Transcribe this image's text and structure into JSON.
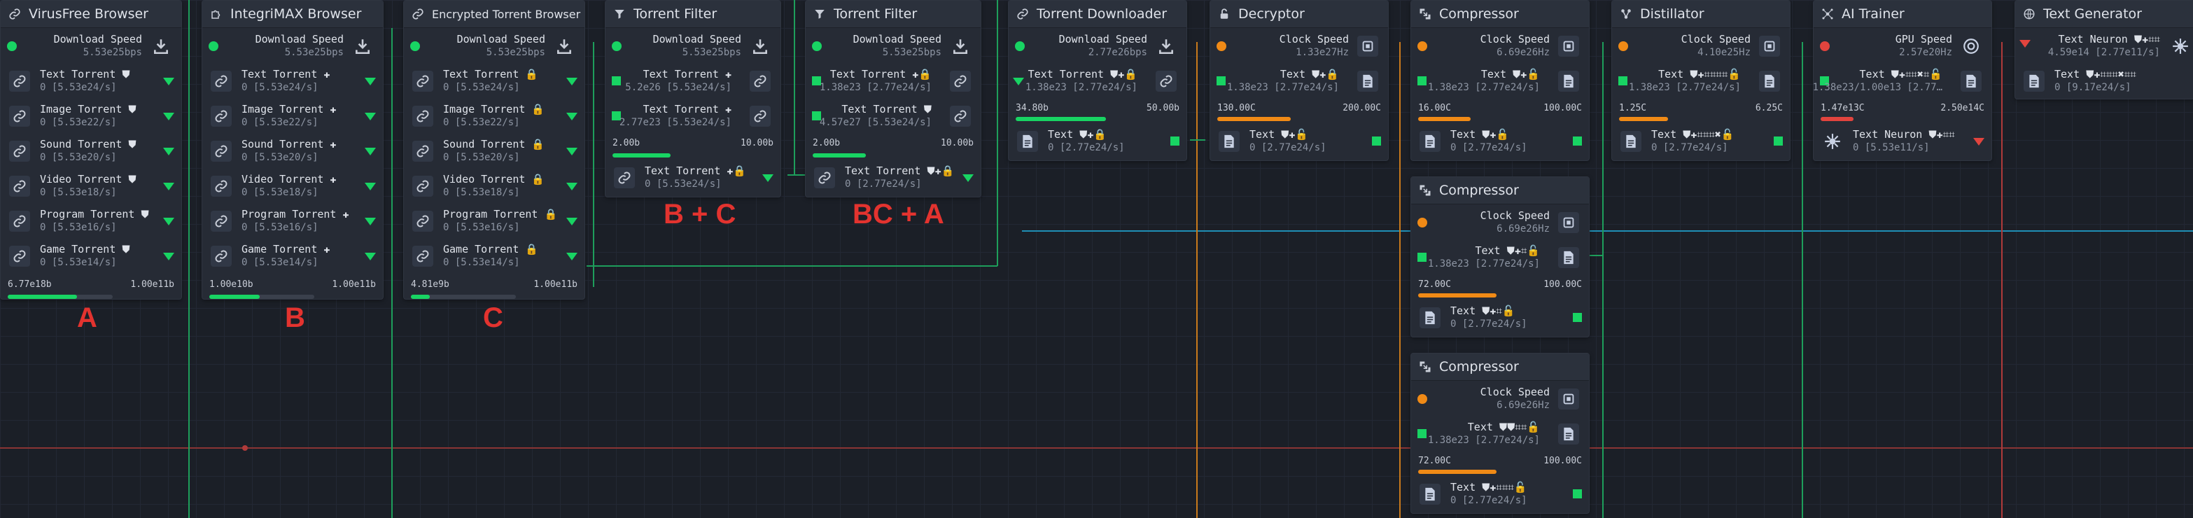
{
  "colors": {
    "green": "#18d463",
    "orange": "#f08a16",
    "red": "#e2443e",
    "bar_green": "#18d463",
    "bar_orange": "#f08a16",
    "bar_red": "#e2443e",
    "wire_green": "#1e9e5b",
    "wire_teal": "#1f8fb5",
    "wire_orange": "#c97a1c",
    "wire_red": "#b03a3a"
  },
  "nodes": {
    "virusfree": {
      "title": "VirusFree Browser",
      "speed_label": "Download Speed",
      "speed_value": "5.53e25bps",
      "items": [
        {
          "label": "Text Torrent ⛊",
          "value": "0 [5.53e24/s]"
        },
        {
          "label": "Image Torrent ⛊",
          "value": "0 [5.53e22/s]"
        },
        {
          "label": "Sound Torrent ⛊",
          "value": "0 [5.53e20/s]"
        },
        {
          "label": "Video Torrent ⛊",
          "value": "0 [5.53e18/s]"
        },
        {
          "label": "Program Torrent ⛊",
          "value": "0 [5.53e16/s]"
        },
        {
          "label": "Game Torrent ⛊",
          "value": "0 [5.53e14/s]"
        }
      ],
      "bar_min": "6.77e18b",
      "bar_max": "1.00e11b",
      "bar_level": 0.66,
      "group": "A"
    },
    "integrimax": {
      "title": "IntegriMAX Browser",
      "speed_label": "Download Speed",
      "speed_value": "5.53e25bps",
      "items": [
        {
          "label": "Text Torrent ✚",
          "value": "0 [5.53e24/s]"
        },
        {
          "label": "Image Torrent ✚",
          "value": "0 [5.53e22/s]"
        },
        {
          "label": "Sound Torrent ✚",
          "value": "0 [5.53e20/s]"
        },
        {
          "label": "Video Torrent ✚",
          "value": "0 [5.53e18/s]"
        },
        {
          "label": "Program Torrent ✚",
          "value": "0 [5.53e16/s]"
        },
        {
          "label": "Game Torrent ✚",
          "value": "0 [5.53e14/s]"
        }
      ],
      "bar_min": "1.00e10b",
      "bar_max": "1.00e11b",
      "bar_level": 0.48,
      "group": "B"
    },
    "encrypted": {
      "title": "Encrypted Torrent Browser",
      "speed_label": "Download Speed",
      "speed_value": "5.53e25bps",
      "items": [
        {
          "label": "Text Torrent 🔒",
          "value": "0 [5.53e24/s]"
        },
        {
          "label": "Image Torrent 🔒",
          "value": "0 [5.53e22/s]"
        },
        {
          "label": "Sound Torrent 🔒",
          "value": "0 [5.53e20/s]"
        },
        {
          "label": "Video Torrent 🔒",
          "value": "0 [5.53e18/s]"
        },
        {
          "label": "Program Torrent 🔒",
          "value": "0 [5.53e16/s]"
        },
        {
          "label": "Game Torrent 🔒",
          "value": "0 [5.53e14/s]"
        }
      ],
      "bar_min": "4.81e9b",
      "bar_max": "1.00e11b",
      "bar_level": 0.18,
      "group": "C"
    },
    "filter1": {
      "title": "Torrent Filter",
      "speed_label": "Download Speed",
      "speed_value": "5.53e25bps",
      "inputs": [
        {
          "label": "Text Torrent ✚",
          "value": "5.2e26 [5.53e24/s]"
        },
        {
          "label": "Text Torrent ✚",
          "value": "2.77e23 [5.53e24/s]"
        }
      ],
      "output": {
        "label": "Text Torrent ✚🔒",
        "value": "0 [5.53e24/s]"
      },
      "bar_min": "2.00b",
      "bar_max": "10.00b",
      "bar_level": 0.36,
      "group": "B + C"
    },
    "filter2": {
      "title": "Torrent Filter",
      "speed_label": "Download Speed",
      "speed_value": "5.53e25bps",
      "inputs": [
        {
          "label": "Text Torrent ✚🔒",
          "value": "1.38e23 [2.77e24/s]"
        },
        {
          "label": "Text Torrent ⛊",
          "value": "4.57e27 [5.53e24/s]"
        }
      ],
      "output": {
        "label": "Text Torrent ⛊✚🔒",
        "value": "0 [2.77e24/s]"
      },
      "bar_min": "2.00b",
      "bar_max": "10.00b",
      "bar_level": 0.33,
      "group": "BC + A"
    },
    "downloader": {
      "title": "Torrent Downloader",
      "speed_label": "Download Speed",
      "speed_value": "2.77e26bps",
      "input": {
        "label": "Text Torrent ⛊✚🔒",
        "value": "1.38e23 [2.77e24/s]"
      },
      "output": {
        "label": "Text ⛊✚🔒",
        "value": "0 [2.77e24/s]"
      },
      "bar_min": "34.80b",
      "bar_max": "50.00b",
      "bar_level": 0.55
    },
    "decryptor": {
      "title": "Decryptor",
      "speed_label": "Clock Speed",
      "speed_value": "1.33e27Hz",
      "input": {
        "label": "Text ⛊✚🔒",
        "value": "1.38e23 [2.77e24/s]"
      },
      "output": {
        "label": "Text ⛊✚🔓",
        "value": "0 [2.77e24/s]"
      },
      "bar_min": "130.00C",
      "bar_max": "200.00C",
      "bar_level": 0.45
    },
    "compressor1": {
      "title": "Compressor",
      "speed_label": "Clock Speed",
      "speed_value": "6.69e26Hz",
      "input": {
        "label": "Text ⛊✚🔓",
        "value": "1.38e23 [2.77e24/s]"
      },
      "output": {
        "label": "Text ⛊✚🔓",
        "value": "0 [2.77e24/s]"
      },
      "bar_min": "16.00C",
      "bar_max": "100.00C",
      "bar_level": 0.32
    },
    "compressor2": {
      "title": "Compressor",
      "speed_label": "Clock Speed",
      "speed_value": "6.69e26Hz",
      "input": {
        "label": "Text ⛊✚⌗🔓",
        "value": "1.38e23 [2.77e24/s]"
      },
      "output": {
        "label": "Text ⛊✚⌗🔓",
        "value": "0 [2.77e24/s]"
      },
      "bar_min": "72.00C",
      "bar_max": "100.00C",
      "bar_level": 0.48
    },
    "compressor3": {
      "title": "Compressor",
      "speed_label": "Clock Speed",
      "speed_value": "6.69e26Hz",
      "input": {
        "label": "Text ⛊⛊⌗⌗🔓",
        "value": "1.38e23 [2.77e24/s]"
      },
      "output": {
        "label": "Text ⛊✚⌗⌗⌗🔓",
        "value": "0 [2.77e24/s]"
      },
      "bar_min": "72.00C",
      "bar_max": "100.00C",
      "bar_level": 0.48
    },
    "distillator": {
      "title": "Distillator",
      "speed_label": "Clock Speed",
      "speed_value": "4.10e25Hz",
      "input": {
        "label": "Text ⛊✚⌗⌗⌗⌗🔓",
        "value": "1.38e23 [2.77e24/s]"
      },
      "output": {
        "label": "Text ⛊✚⌗⌗⌗✖🔓",
        "value": "0 [2.77e24/s]"
      },
      "bar_min": "1.25C",
      "bar_max": "6.25C",
      "bar_level": 0.3
    },
    "aitrainer": {
      "title": "AI Trainer",
      "speed_label": "GPU Speed",
      "speed_value": "2.57e20Hz",
      "input": {
        "label": "Text ⛊✚⌗⌗✖⌗🔓",
        "value": "1.38e23/1.00e13 [2.77…"
      },
      "output": {
        "label": "Text Neuron ⛊✚⌗⌗",
        "value": "0 [5.53e11/s]"
      },
      "bar_min": "1.47e13C",
      "bar_max": "2.50e14C",
      "bar_level": 0.2
    },
    "textgen": {
      "title": "Text Generator",
      "input": {
        "label": "Text Neuron ⛊✚⌗⌗",
        "value": "4.59e14 [2.77e11/s]"
      },
      "output": {
        "label": "Text ⛊✚⌗⌗⌗✖⌗⌗",
        "value": "0 [9.17e24/s]"
      }
    }
  }
}
